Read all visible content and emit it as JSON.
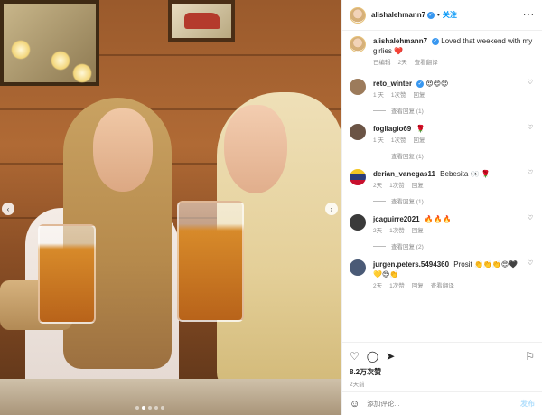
{
  "post": {
    "username": "alishalehmann7",
    "follow_label": "关注",
    "more_icon": "more-horizontal-icon",
    "caption": {
      "username": "alishalehmann7",
      "text": "Loved that weekend with my girlies ❤️",
      "edited": "已编辑",
      "time": "2天",
      "translate": "查看翻译"
    },
    "photo": {
      "slide_count": 5,
      "active_slide": 2
    }
  },
  "comments": [
    {
      "username": "reto_winter",
      "text": "😍😍😍",
      "time": "1 天",
      "likes": "1次赞",
      "reply": "回复",
      "replies": "查看回复 (1)",
      "avatar_color": "#9c7b5b"
    },
    {
      "username": "fogliagio69",
      "text": "🌹",
      "time": "1 天",
      "likes": "1次赞",
      "reply": "回复",
      "replies": "查看回复 (1)",
      "avatar_color": "#6b5445"
    },
    {
      "username": "derian_vanegas11",
      "text": "Bebesita 👀 🌹",
      "time": "2天",
      "likes": "1次赞",
      "reply": "回复",
      "replies": "查看回复 (1)",
      "avatar_color": "#2c3d7a"
    },
    {
      "username": "jcaguirre2021",
      "text": "🔥🔥🔥",
      "time": "2天",
      "likes": "1次赞",
      "reply": "回复",
      "replies": "查看回复 (2)",
      "avatar_color": "#3a3a3a"
    },
    {
      "username": "jurgen.peters.5494360",
      "text": "Prosit 👏👏👏😍🖤💛😍👏",
      "time": "2天",
      "likes": "1次赞",
      "reply": "回复",
      "translate": "查看翻译",
      "avatar_color": "#4a5a76"
    }
  ],
  "actions": {
    "like_icon": "heart-icon",
    "comment_icon": "comment-icon",
    "share_icon": "share-icon",
    "save_icon": "bookmark-icon",
    "likes": "8.2万次赞",
    "date": "2天前"
  },
  "add_comment": {
    "emoji_icon": "smiley-icon",
    "placeholder": "添加评论...",
    "post_label": "发布"
  }
}
